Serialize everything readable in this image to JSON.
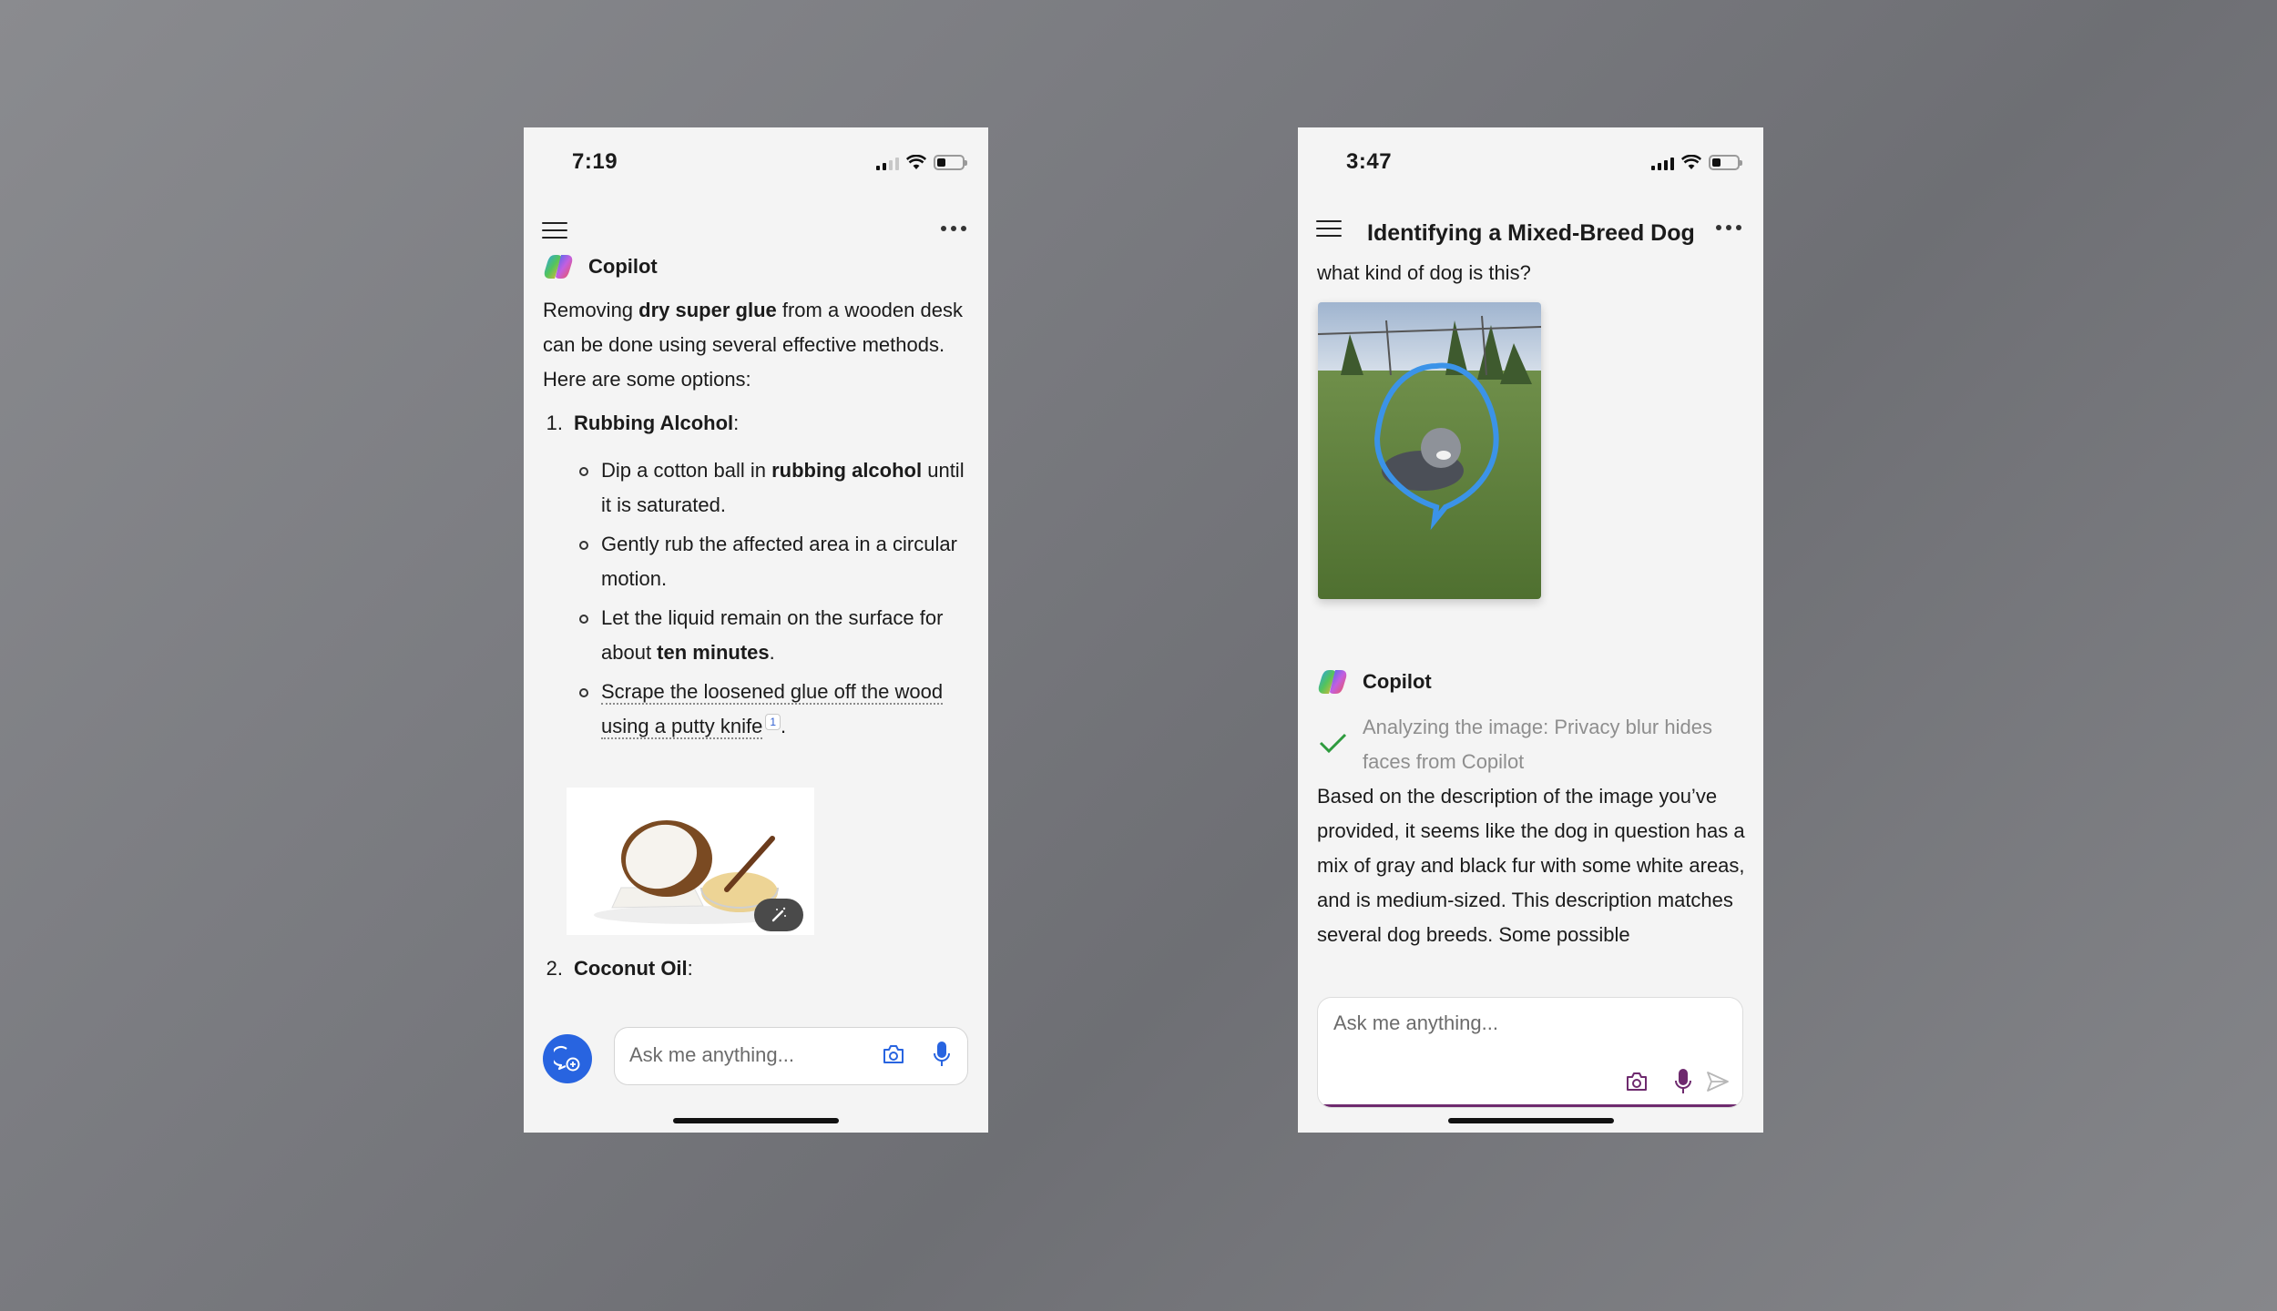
{
  "left_phone": {
    "status": {
      "time": "7:19",
      "signal_bars": 2,
      "battery_level": 0.3
    },
    "nav": {
      "menu_icon": "hamburger-icon",
      "more_icon": "more-horizontal-icon"
    },
    "sender": "Copilot",
    "intro": {
      "t1": "Removing ",
      "b1": "dry super glue",
      "t2": " from a wooden desk can be done using several effective methods. Here are some options:"
    },
    "methods": [
      {
        "num": "1.",
        "title": "Rubbing Alcohol",
        "suffix": ":",
        "steps": [
          {
            "t1": "Dip a cotton ball in ",
            "b": "rubbing alcohol",
            "t2": " until it is saturated."
          },
          {
            "t1": "Gently rub the affected area in a circular motion."
          },
          {
            "t1": "Let the liquid remain on the surface for about ",
            "b": "ten minutes",
            "t2": "."
          },
          {
            "link": "Scrape the loosened glue off the wood using a putty knife",
            "cite": "1",
            "t2": "."
          }
        ]
      },
      {
        "num": "2.",
        "title": "Coconut Oil",
        "suffix": ":"
      }
    ],
    "image": {
      "subject": "coconut and coconut oil",
      "action_icon": "magic-wand-icon"
    },
    "composer": {
      "placeholder": "Ask me anything...",
      "new_chat_icon": "new-chat-icon",
      "camera_icon": "camera-icon",
      "mic_icon": "microphone-icon",
      "accent": "#2864e0"
    }
  },
  "right_phone": {
    "status": {
      "time": "3:47",
      "signal_bars": 4,
      "battery_level": 0.3
    },
    "nav": {
      "title": "Identifying a Mixed-Breed Dog"
    },
    "user_message": "what kind of dog is this?",
    "user_image": {
      "subject": "dog in tall grass circled in blue"
    },
    "sender": "Copilot",
    "analysis_status": "Analyzing the image: Privacy blur hides faces from Copilot",
    "response": "Based on the description of the image you’ve provided, it seems like the dog in question has a mix of gray and black fur with some white areas, and is medium-sized. This description matches several dog breeds. Some possible",
    "composer": {
      "placeholder": "Ask me anything...",
      "accent": "#6e2a6e"
    }
  }
}
